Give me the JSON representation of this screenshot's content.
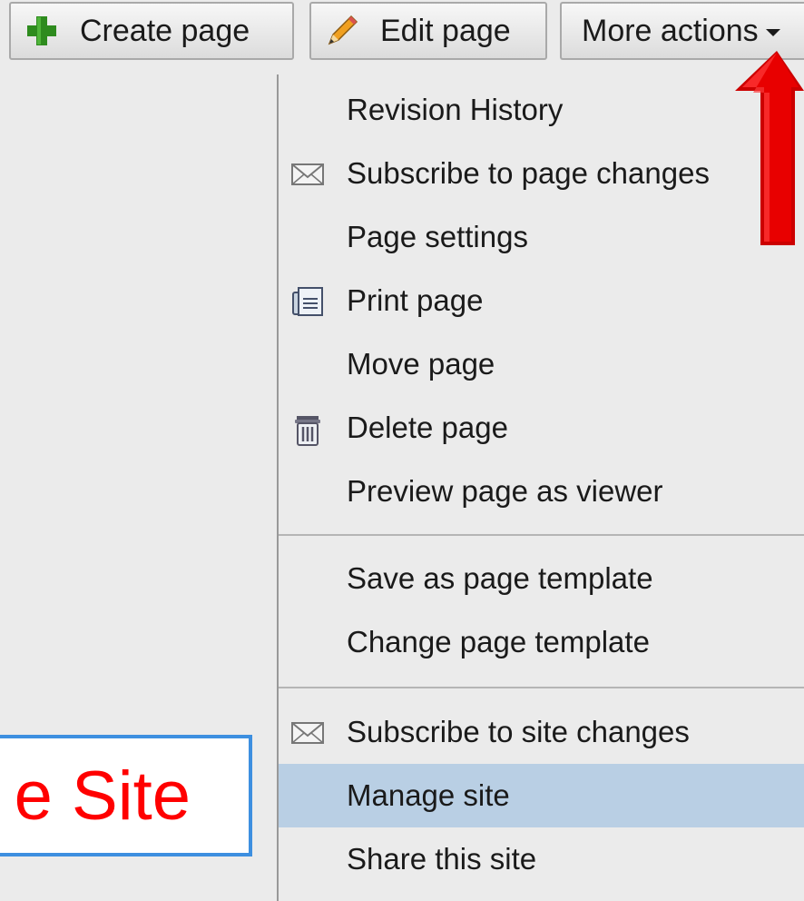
{
  "toolbar": {
    "create_label": "Create page",
    "create_icon": "plus-icon",
    "edit_label": "Edit page",
    "edit_icon": "pencil-icon",
    "more_label": "More actions",
    "more_icon": "caret-down-icon"
  },
  "menu": {
    "items": [
      {
        "label": "Revision History",
        "icon": null
      },
      {
        "label": "Subscribe to page changes",
        "icon": "envelope-icon"
      },
      {
        "label": "Page settings",
        "icon": null
      },
      {
        "label": "Print page",
        "icon": "printer-icon"
      },
      {
        "label": "Move page",
        "icon": null
      },
      {
        "label": "Delete page",
        "icon": "trash-icon"
      },
      {
        "label": "Preview page as viewer",
        "icon": null
      },
      {
        "label": "Save as page template",
        "icon": null
      },
      {
        "label": "Change page template",
        "icon": null
      },
      {
        "label": "Subscribe to site changes",
        "icon": "envelope-icon"
      },
      {
        "label": "Manage site",
        "icon": null,
        "highlighted": true
      },
      {
        "label": "Share this site",
        "icon": null
      }
    ]
  },
  "callout": {
    "text": "e Site"
  },
  "colors": {
    "background": "#ebebeb",
    "highlight": "#b9cfe4",
    "annotation_red": "#ff0000",
    "callout_border": "#3d8fe0"
  }
}
